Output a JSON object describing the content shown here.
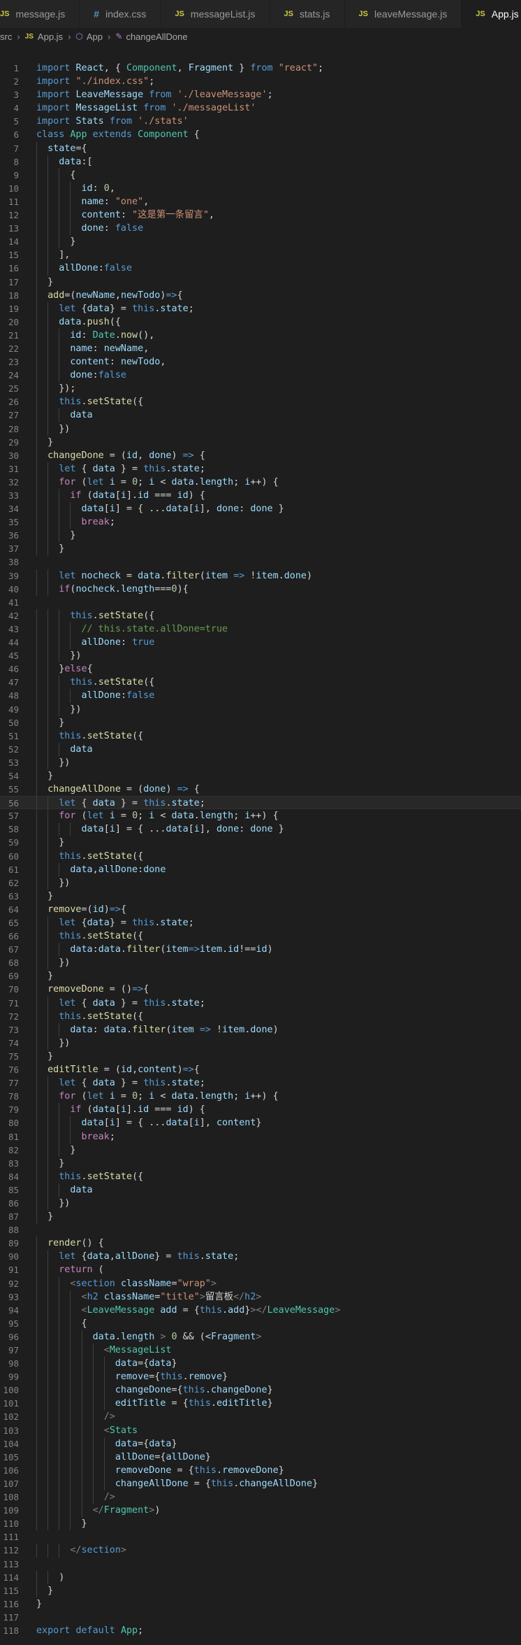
{
  "tabs": [
    {
      "label": "message.js",
      "icon": "js"
    },
    {
      "label": "index.css",
      "icon": "css"
    },
    {
      "label": "messageList.js",
      "icon": "js"
    },
    {
      "label": "stats.js",
      "icon": "js"
    },
    {
      "label": "leaveMessage.js",
      "icon": "js"
    },
    {
      "label": "App.js",
      "icon": "js",
      "active": true
    }
  ],
  "tab_icons": {
    "js": "JS",
    "css": "#"
  },
  "close_glyph": "✕",
  "breadcrumb": {
    "folder": "src",
    "file": "App.js",
    "file_icon": "JS",
    "class": "App",
    "method": "changeAllDone"
  },
  "cursor_line": 56,
  "colors": {
    "background": "#1e1e1e",
    "keyword": "#569cd6",
    "control": "#c586c0",
    "string": "#ce9178",
    "function": "#dcdcaa",
    "variable": "#9cdcfe",
    "type": "#4ec9b0",
    "number": "#b5cea8",
    "comment": "#6a9955",
    "tag": "#808080"
  },
  "lines": [
    "import React, { Component, Fragment } from \"react\";",
    "import \"./index.css\";",
    "import LeaveMessage from './leaveMessage';",
    "import MessageList from './messageList'",
    "import Stats from './stats'",
    "class App extends Component {",
    "  state={",
    "    data:[",
    "      {",
    "        id: 0,",
    "        name: \"one\",",
    "        content: \"这是第一条留言\",",
    "        done: false",
    "      }",
    "    ],",
    "    allDone:false",
    "  }",
    "  add=(newName,newTodo)=>{",
    "    let {data} = this.state;",
    "    data.push({",
    "      id: Date.now(),",
    "      name: newName,",
    "      content: newTodo,",
    "      done:false",
    "    });",
    "    this.setState({",
    "      data",
    "    })",
    "  }",
    "  changeDone = (id, done) => {",
    "    let { data } = this.state;",
    "    for (let i = 0; i < data.length; i++) {",
    "      if (data[i].id === id) {",
    "        data[i] = { ...data[i], done: done }",
    "        break;",
    "      }",
    "    }",
    "",
    "    let nocheck = data.filter(item => !item.done)",
    "    if(nocheck.length===0){",
    "",
    "      this.setState({",
    "        // this.state.allDone=true",
    "        allDone: true",
    "      })",
    "    }else{",
    "      this.setState({",
    "        allDone:false",
    "      })",
    "    }",
    "    this.setState({",
    "      data",
    "    })",
    "  }",
    "  changeAllDone = (done) => {",
    "    let { data } = this.state;",
    "    for (let i = 0; i < data.length; i++) {",
    "        data[i] = { ...data[i], done: done }",
    "    }",
    "    this.setState({",
    "      data,allDone:done",
    "    })",
    "  }",
    "  remove=(id)=>{",
    "    let {data} = this.state;",
    "    this.setState({",
    "      data:data.filter(item=>item.id!==id)",
    "    })",
    "  }",
    "  removeDone = ()=>{",
    "    let { data } = this.state;",
    "    this.setState({",
    "      data: data.filter(item => !item.done)",
    "    })",
    "  }",
    "  editTitle = (id,content)=>{",
    "    let { data } = this.state;",
    "    for (let i = 0; i < data.length; i++) {",
    "      if (data[i].id === id) {",
    "        data[i] = { ...data[i], content}",
    "        break;",
    "      }",
    "    }",
    "    this.setState({",
    "      data",
    "    })",
    "  }",
    "",
    "  render() {",
    "    let {data,allDone} = this.state;",
    "    return (",
    "      <section className=\"wrap\">",
    "        <h2 className=\"title\">留言板</h2>",
    "        <LeaveMessage add = {this.add}></LeaveMessage>",
    "        {",
    "          data.length > 0 && (<Fragment>",
    "            <MessageList",
    "              data={data}",
    "              remove={this.remove}",
    "              changeDone={this.changeDone}",
    "              editTitle = {this.editTitle}",
    "            />",
    "            <Stats",
    "              data={data}",
    "              allDone={allDone}",
    "              removeDone = {this.removeDone}",
    "              changeAllDone = {this.changeAllDone}",
    "            />",
    "          </Fragment>)",
    "        }",
    "",
    "      </section>",
    "",
    "    )",
    "  }",
    "}",
    "",
    "export default App;"
  ]
}
